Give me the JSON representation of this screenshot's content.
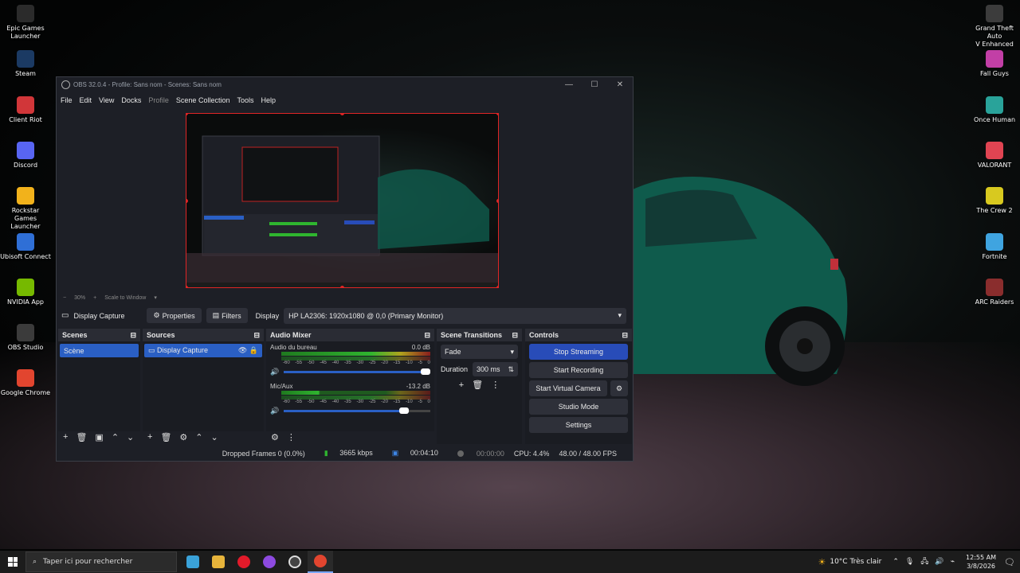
{
  "desktop": {
    "left_icons": [
      {
        "label": "Epic Games\nLauncher",
        "icon": "epic-icon",
        "color": "#2b2b2b"
      },
      {
        "label": "Steam",
        "icon": "steam-icon",
        "color": "#1b3a63"
      },
      {
        "label": "Client Riot",
        "icon": "riot-icon",
        "color": "#d13639"
      },
      {
        "label": "Discord",
        "icon": "discord-icon",
        "color": "#5865f2"
      },
      {
        "label": "Rockstar Games\nLauncher",
        "icon": "rockstar-icon",
        "color": "#f2b21b"
      },
      {
        "label": "Ubisoft Connect",
        "icon": "ubisoft-icon",
        "color": "#2f6fd6"
      },
      {
        "label": "NVIDIA App",
        "icon": "nvidia-icon",
        "color": "#76b900"
      },
      {
        "label": "OBS Studio",
        "icon": "obs-icon",
        "color": "#3b3b3b"
      },
      {
        "label": "Google Chrome",
        "icon": "chrome-icon",
        "color": "#e2452f"
      }
    ],
    "right_icons": [
      {
        "label": "Grand Theft Auto\nV Enhanced",
        "icon": "gta-icon",
        "color": "#3c3c3c"
      },
      {
        "label": "Fall Guys",
        "icon": "fallguys-icon",
        "color": "#c23fa6"
      },
      {
        "label": "Once Human",
        "icon": "oncehuman-icon",
        "color": "#29a39a"
      },
      {
        "label": "VALORANT",
        "icon": "valorant-icon",
        "color": "#e04452"
      },
      {
        "label": "The Crew 2",
        "icon": "thecrew-icon",
        "color": "#d8c91f"
      },
      {
        "label": "Fortnite",
        "icon": "fortnite-icon",
        "color": "#3fa4e0"
      },
      {
        "label": "ARC Raiders",
        "icon": "arc-icon",
        "color": "#8a2d2d"
      }
    ]
  },
  "obs": {
    "title": "OBS 32.0.4 - Profile: Sans nom - Scenes: Sans nom",
    "menu": [
      "File",
      "Edit",
      "View",
      "Docks",
      "Profile",
      "Scene Collection",
      "Tools",
      "Help"
    ],
    "zoom": {
      "minus": "−",
      "value": "30%",
      "plus": "+",
      "mode": "Scale to Window"
    },
    "source_bar": {
      "source_name": "Display Capture",
      "properties": "Properties",
      "filters": "Filters",
      "display_label": "Display",
      "display_value": "HP LA2306: 1920x1080 @ 0,0 (Primary Monitor)"
    },
    "scenes": {
      "title": "Scenes",
      "items": [
        "Scène"
      ]
    },
    "sources": {
      "title": "Sources",
      "items": [
        "Display Capture"
      ]
    },
    "mixer": {
      "title": "Audio Mixer",
      "channels": [
        {
          "name": "Audio du bureau",
          "db": "0.0 dB",
          "level": 0.97
        },
        {
          "name": "Mic/Aux",
          "db": "-13.2 dB",
          "level": 0.82
        }
      ],
      "ticks": [
        "-60",
        "-55",
        "-50",
        "-45",
        "-40",
        "-35",
        "-30",
        "-25",
        "-20",
        "-15",
        "-10",
        "-5",
        "0"
      ]
    },
    "transitions": {
      "title": "Scene Transitions",
      "type": "Fade",
      "duration_label": "Duration",
      "duration_value": "300 ms"
    },
    "controls": {
      "title": "Controls",
      "stop_streaming": "Stop Streaming",
      "start_recording": "Start Recording",
      "start_virtual_camera": "Start Virtual Camera",
      "studio_mode": "Studio Mode",
      "settings": "Settings"
    },
    "status": {
      "dropped_frames": "Dropped Frames 0 (0.0%)",
      "bitrate": "3665 kbps",
      "stream_time": "00:04:10",
      "record_time": "00:00:00",
      "cpu": "CPU: 4.4%",
      "fps": "48.00 / 48.00 FPS"
    },
    "colors": {
      "accent": "#284cb8",
      "selection": "#2a5fc4",
      "preview_border": "#e02525"
    }
  },
  "taskbar": {
    "search_placeholder": "Taper ici pour rechercher",
    "weather": "10°C  Très clair",
    "time": "12:55 AM",
    "date": "3/8/2026"
  }
}
